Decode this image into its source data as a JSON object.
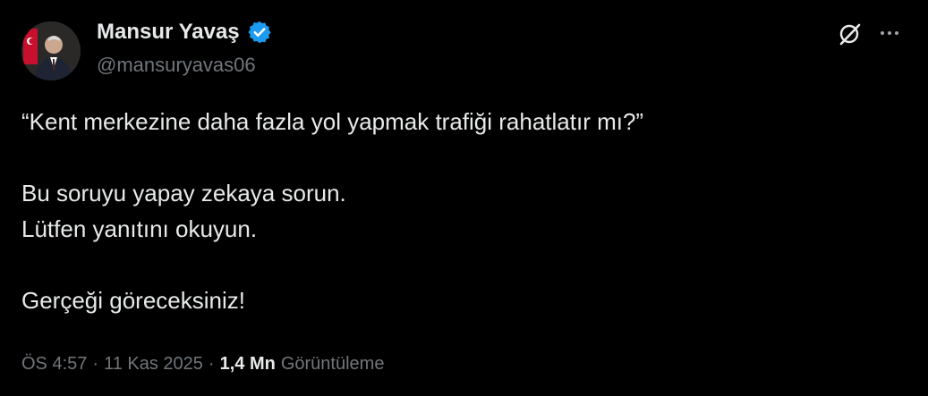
{
  "author": {
    "name": "Mansur Yavaş",
    "handle": "@mansuryavas06",
    "verified": true
  },
  "tweet": {
    "line1": "“Kent merkezine daha fazla yol yapmak trafiği rahatlatır mı?”",
    "line2": "Bu soruyu yapay zekaya sorun.",
    "line3": "Lütfen yanıtını okuyun.",
    "line4": "Gerçeği göreceksiniz!"
  },
  "meta": {
    "time": "ÖS 4:57",
    "separator": "·",
    "date": "11 Kas 2025",
    "views_count": "1,4 Mn",
    "views_label": "Görüntüleme"
  },
  "icons": {
    "verified": "verified-badge",
    "grok": "grok-icon",
    "more": "more-icon"
  },
  "colors": {
    "background": "#000000",
    "text": "#e7e9ea",
    "secondary": "#71767b",
    "verified": "#1d9bf0"
  }
}
